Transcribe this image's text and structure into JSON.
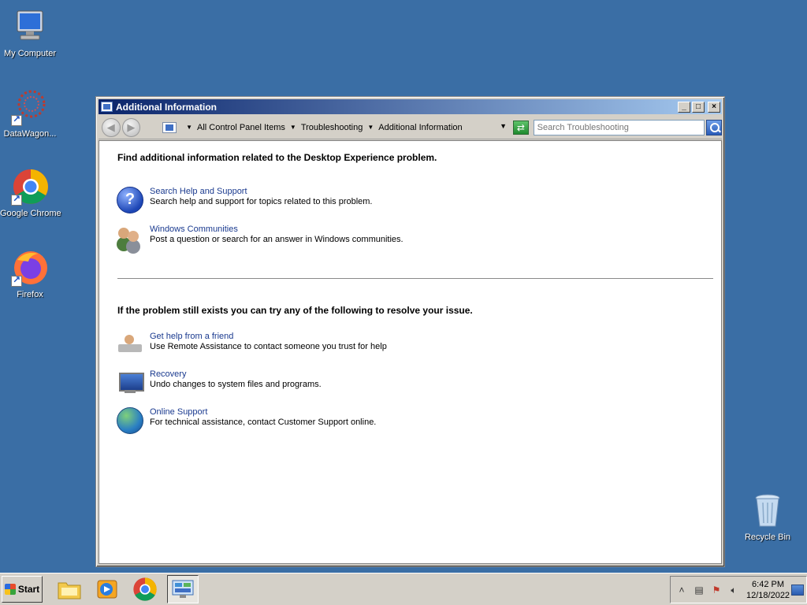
{
  "desktop": {
    "icons": [
      {
        "label": "My Computer",
        "icon": "computer-icon"
      },
      {
        "label": "DataWagon...",
        "icon": "datawagon-icon"
      },
      {
        "label": "Google Chrome",
        "icon": "chrome-icon"
      },
      {
        "label": "Firefox",
        "icon": "firefox-icon"
      },
      {
        "label": "Recycle Bin",
        "icon": "recycle-bin-icon"
      }
    ]
  },
  "window": {
    "title": "Additional Information",
    "buttons": {
      "minimize": "_",
      "maximize": "□",
      "close": "×"
    },
    "breadcrumb": [
      "All Control Panel Items",
      "Troubleshooting",
      "Additional Information"
    ],
    "search_placeholder": "Search Troubleshooting",
    "section1_heading": "Find additional information related to the Desktop Experience problem.",
    "section1_items": [
      {
        "link": "Search Help and Support",
        "desc": "Search help and support for topics related to this problem.",
        "icon": "help-icon"
      },
      {
        "link": "Windows Communities",
        "desc": "Post a question or search for an answer in Windows communities.",
        "icon": "people-icon"
      }
    ],
    "section2_heading": "If the problem still exists you can try any of the following to resolve your issue.",
    "section2_items": [
      {
        "link": "Get help from a friend",
        "desc": "Use Remote Assistance to contact someone you trust for help",
        "icon": "remote-assistance-icon"
      },
      {
        "link": "Recovery",
        "desc": "Undo changes to system files and programs.",
        "icon": "recovery-icon"
      },
      {
        "link": "Online Support",
        "desc": "For technical assistance, contact Customer Support online.",
        "icon": "globe-icon"
      }
    ]
  },
  "taskbar": {
    "start_label": "Start",
    "clock_time": "6:42 PM",
    "clock_date": "12/18/2022"
  }
}
